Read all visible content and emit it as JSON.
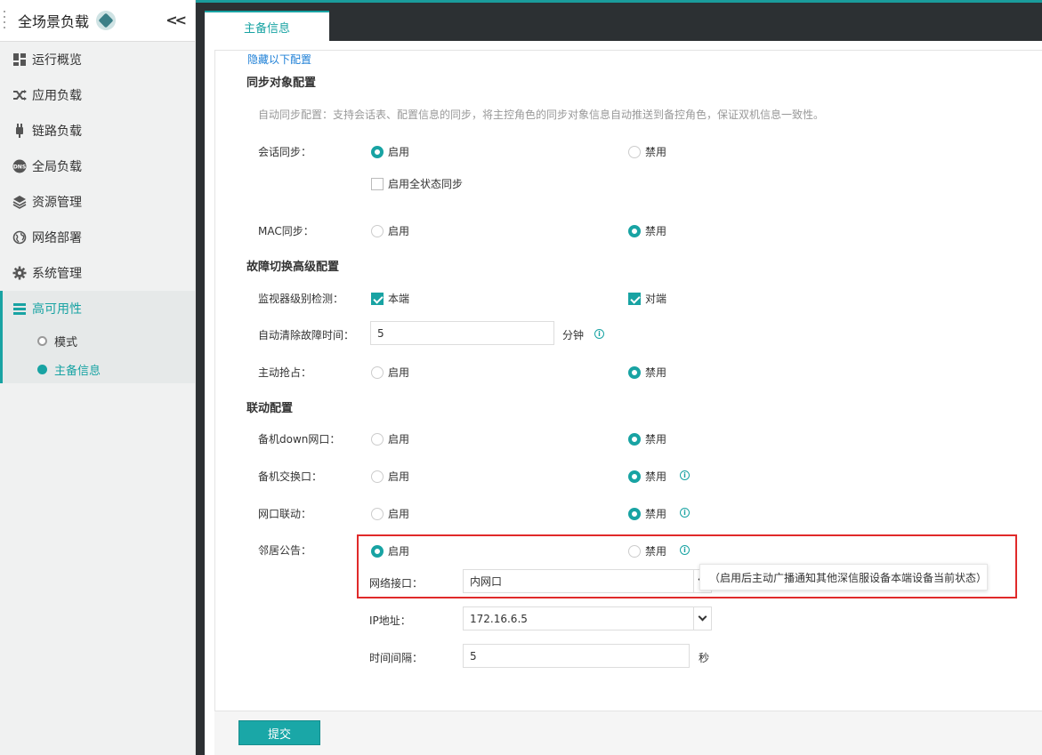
{
  "sidebar": {
    "title": "全场景负载",
    "collapse_icon": "double-chevron-left-icon",
    "nav": [
      {
        "label": "运行概览",
        "icon": "dashboard-icon"
      },
      {
        "label": "应用负载",
        "icon": "shuffle-icon"
      },
      {
        "label": "链路负载",
        "icon": "plug-icon"
      },
      {
        "label": "全局负载",
        "icon": "dns-icon"
      },
      {
        "label": "资源管理",
        "icon": "layers-icon"
      },
      {
        "label": "网络部署",
        "icon": "globe-icon"
      },
      {
        "label": "系统管理",
        "icon": "gear-icon"
      },
      {
        "label": "高可用性",
        "icon": "list-icon"
      }
    ],
    "sub": [
      {
        "label": "模式"
      },
      {
        "label": "主备信息"
      }
    ]
  },
  "tab": {
    "label": "主备信息"
  },
  "form": {
    "hide_link": "隐藏以下配置",
    "sync_section": "同步对象配置",
    "sync_desc": "自动同步配置：支持会话表、配置信息的同步，将主控角色的同步对象信息自动推送到备控角色，保证双机信息一致性。",
    "session_sync": {
      "label": "会话同步：",
      "enable": "启用",
      "disable": "禁用",
      "full_state": "启用全状态同步"
    },
    "mac_sync": {
      "label": "MAC同步：",
      "enable": "启用",
      "disable": "禁用"
    },
    "failover_section": "故障切换高级配置",
    "monitor": {
      "label": "监视器级别检测：",
      "local": "本端",
      "peer": "对端"
    },
    "auto_clear": {
      "label": "自动清除故障时间：",
      "value": "5",
      "unit": "分钟"
    },
    "preempt": {
      "label": "主动抢占：",
      "enable": "启用",
      "disable": "禁用"
    },
    "linkage_section": "联动配置",
    "standby_down": {
      "label": "备机down网口：",
      "enable": "启用",
      "disable": "禁用"
    },
    "standby_switch": {
      "label": "备机交换口：",
      "enable": "启用",
      "disable": "禁用"
    },
    "port_link": {
      "label": "网口联动：",
      "enable": "启用",
      "disable": "禁用"
    },
    "neighbor": {
      "label": "邻居公告：",
      "enable": "启用",
      "disable": "禁用"
    },
    "net_iface": {
      "label": "网络接口：",
      "value": "内网口"
    },
    "ip": {
      "label": "IP地址：",
      "value": "172.16.6.5"
    },
    "interval": {
      "label": "时间间隔：",
      "value": "5",
      "unit": "秒"
    },
    "tooltip": "（启用后主动广播通知其他深信服设备本端设备当前状态）",
    "submit": "提交"
  },
  "colors": {
    "accent": "#18a3a3",
    "highlight": "#e02a2a"
  }
}
